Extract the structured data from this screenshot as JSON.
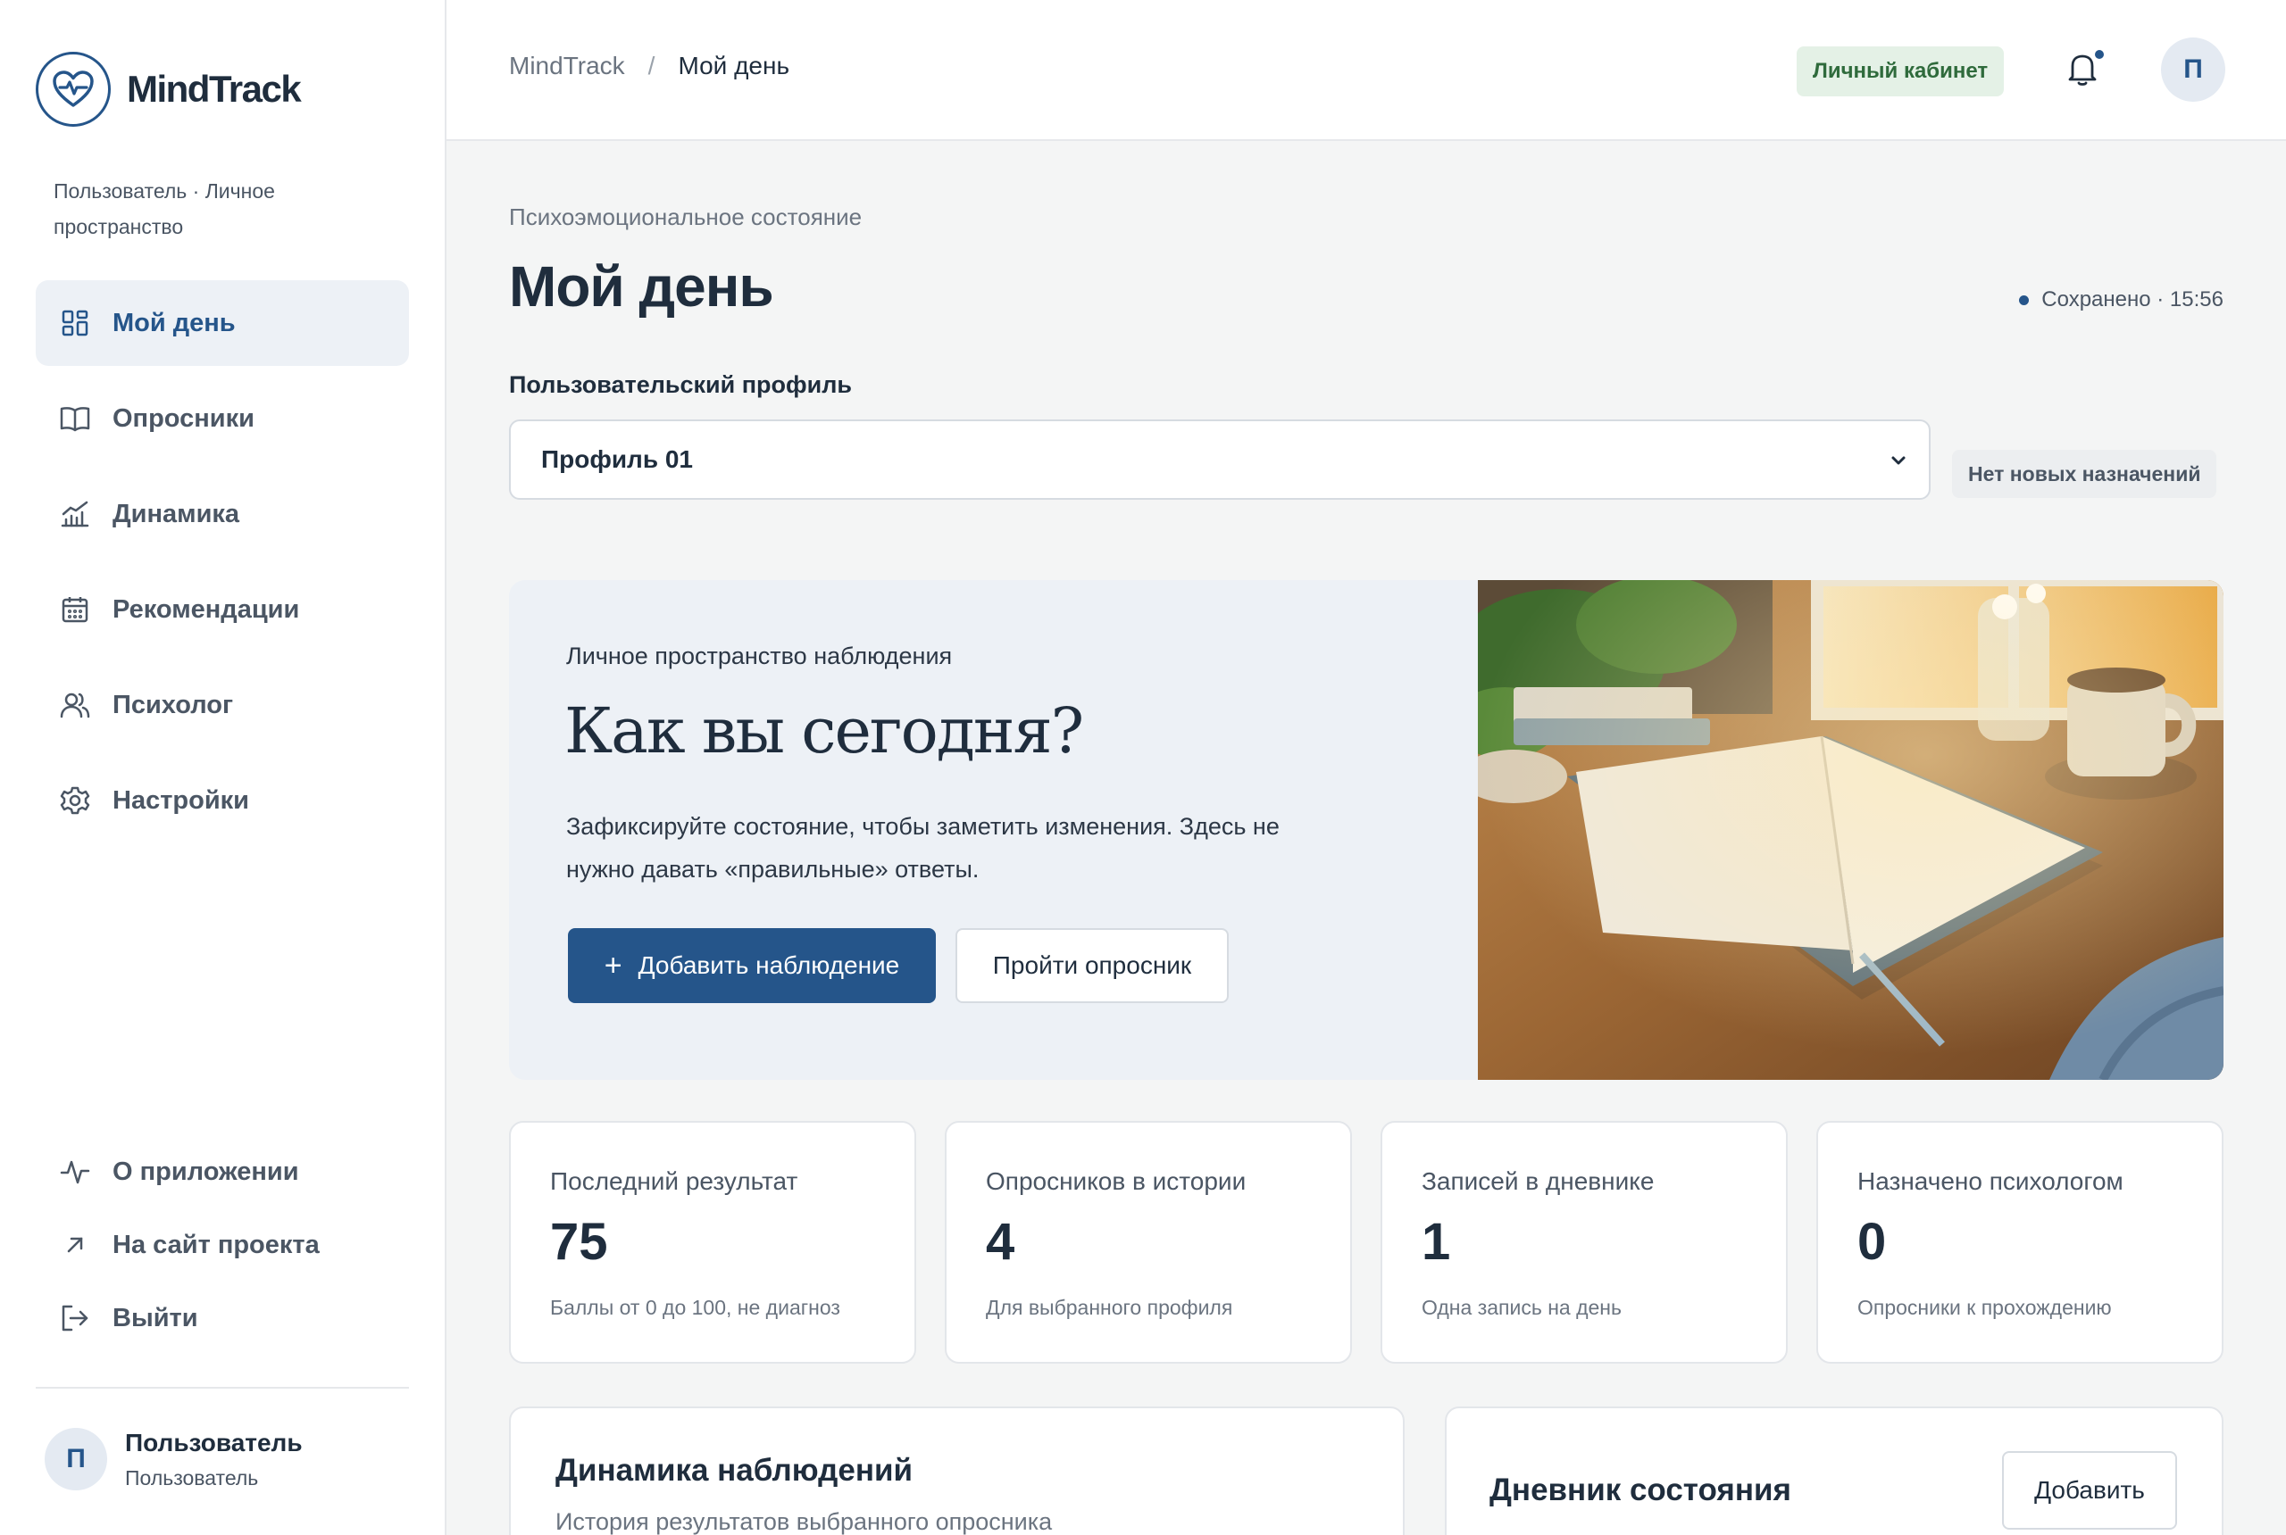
{
  "app": {
    "name": "MindTrack",
    "subtitle": "Пользователь · Личное пространство"
  },
  "sidebar": {
    "items": [
      {
        "label": "Мой день",
        "icon": "dashboard-grid-icon",
        "active": true
      },
      {
        "label": "Опросники",
        "icon": "book-icon"
      },
      {
        "label": "Динамика",
        "icon": "chart-icon"
      },
      {
        "label": "Рекомендации",
        "icon": "calendar-icon"
      },
      {
        "label": "Психолог",
        "icon": "users-icon"
      },
      {
        "label": "Настройки",
        "icon": "gear-icon"
      }
    ],
    "bottom": [
      {
        "label": "О приложении",
        "icon": "pulse-icon"
      },
      {
        "label": "На сайт проекта",
        "icon": "arrow-up-right-icon"
      },
      {
        "label": "Выйти",
        "icon": "logout-icon"
      }
    ],
    "user": {
      "initial": "П",
      "name": "Пользователь",
      "role": "Пользователь"
    }
  },
  "topbar": {
    "breadcrumb_root": "MindTrack",
    "breadcrumb_sep": "/",
    "breadcrumb_current": "Мой день",
    "cabinet_badge": "Личный кабинет",
    "avatar_initial": "П"
  },
  "main": {
    "eyebrow": "Психоэмоциональное состояние",
    "title": "Мой день",
    "saved": "Сохранено · 15:56",
    "profile_label": "Пользовательский профиль",
    "profile_value": "Профиль 01",
    "no_tasks": "Нет новых назначений"
  },
  "hero": {
    "eyebrow": "Личное пространство наблюдения",
    "title": "Как вы сегодня?",
    "text": "Зафиксируйте состояние, чтобы заметить изменения. Здесь не нужно давать «правильные» ответы.",
    "primary_button": "Добавить наблюдение",
    "secondary_button": "Пройти опросник"
  },
  "stats": [
    {
      "label": "Последний результат",
      "value": "75",
      "note": "Баллы от 0 до 100, не диагноз"
    },
    {
      "label": "Опросников в истории",
      "value": "4",
      "note": "Для выбранного профиля"
    },
    {
      "label": "Записей в дневнике",
      "value": "1",
      "note": "Одна запись на день"
    },
    {
      "label": "Назначено психологом",
      "value": "0",
      "note": "Опросники к прохождению"
    }
  ],
  "dynamics_card": {
    "title": "Динамика наблюдений",
    "subtitle": "История результатов выбранного опросника"
  },
  "diary_card": {
    "title": "Дневник состояния",
    "button": "Добавить"
  },
  "colors": {
    "accent": "#25558a",
    "badge_green_bg": "#e4f1e6",
    "badge_green_text": "#2f6b3c",
    "page_bg": "#f4f5f5"
  }
}
